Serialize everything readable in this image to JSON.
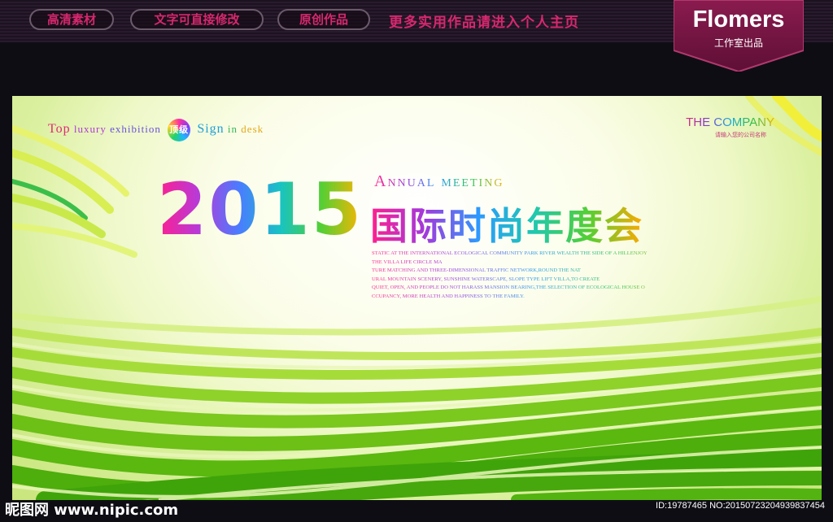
{
  "header": {
    "pills": [
      "高清素材",
      "文字可直接修改",
      "原创作品"
    ],
    "promo": "更多实用作品请进入个人主页",
    "brand": "Flomers",
    "brand_sub": "工作室出品"
  },
  "board": {
    "lux_line": [
      "Top",
      "luxury",
      "exhibition",
      "Sign",
      "in",
      "desk"
    ],
    "seal_text": "顶级",
    "company": "THE COMPANY",
    "company_sub": "请输入您的公司名称",
    "year": "2015",
    "annual": "Annual meeting",
    "title": "国际时尚年度会",
    "paragraph": [
      "STATIC AT THE INTERNATIONAL ECOLOGICAL COMMUNITY PARK RIVER WEALTH THE SIDE OF A HILLENJOY",
      "THE VILLA LIFE CIRCLE MA",
      "TURE MATCHING AND THREE-DIMENSIONAL TRAFFIC NETWORK,ROUND THE NAT",
      "URAL MOUNTAIN SCENERY, SUNSHINE WATERSCAPE, SLOPE TYPE LIFT VILLA,TO CREATE",
      "QUIET, OPEN, AND PEOPLE DO NOT HARASS MANSION BEARING,THE SELECTION OF ECOLOGICAL HOUSE O",
      "CCUPANCY, MORE HEALTH AND HAPPINESS TO THE FAMILY."
    ]
  },
  "watermark": {
    "left": "昵图网 www.nipic.com",
    "right": "ID:19787465 NO:20150723204939837454"
  },
  "colors": {
    "accent_pink": "#d6286e",
    "green": "#6fc21a"
  }
}
